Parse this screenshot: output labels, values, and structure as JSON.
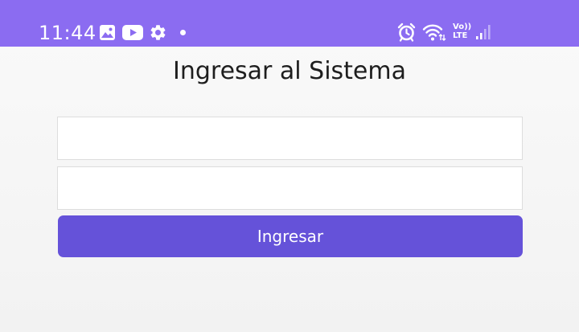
{
  "status_bar": {
    "time": "11:44",
    "volte_top": "Vo))",
    "volte_bottom": "LTE",
    "color": "#8b6cf1",
    "icons": [
      "gallery-icon",
      "youtube-icon",
      "gear-icon",
      "dot-icon",
      "alarm-icon",
      "wifi-icon",
      "volte-icon",
      "signal-icon"
    ]
  },
  "login": {
    "title": "Ingresar al Sistema",
    "username_value": "",
    "username_placeholder": "",
    "password_value": "",
    "password_placeholder": "",
    "submit_label": "Ingresar",
    "accent_color": "#6552d9"
  }
}
